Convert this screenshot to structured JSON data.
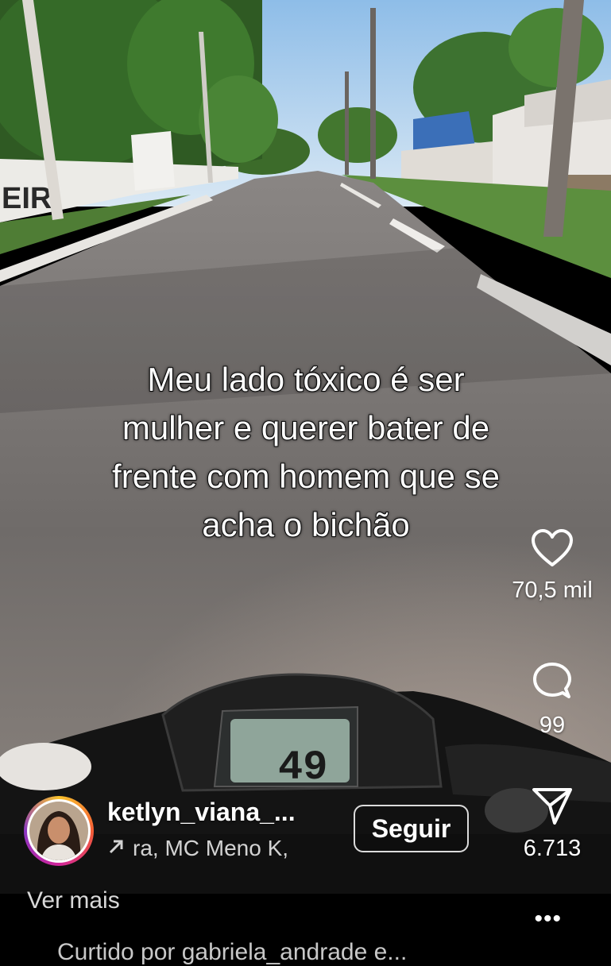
{
  "caption": {
    "line1": "Meu lado tóxico é ser",
    "line2": "mulher e querer bater de",
    "line3": "frente com homem que se",
    "line4": "acha o bichão"
  },
  "actions": {
    "likes": "70,5 mil",
    "comments": "99",
    "shares": "6.713",
    "like_icon": "heart-icon",
    "comment_icon": "comment-bubble-icon",
    "share_icon": "paper-plane-icon"
  },
  "author": {
    "username": "ketlyn_viana_...",
    "music": "ra, MC Meno K,",
    "follow_label": "Seguir"
  },
  "footer": {
    "see_more": "Ver mais",
    "more_icon": "•••",
    "liked_by": "Curtido por gabriela_andrade e..."
  },
  "scene": {
    "wall_lettering": "EIR",
    "speedometer": "49"
  },
  "colors": {
    "sky": "#bcd6f0",
    "road": "#7d7878",
    "follow_border": "#ffffff"
  }
}
